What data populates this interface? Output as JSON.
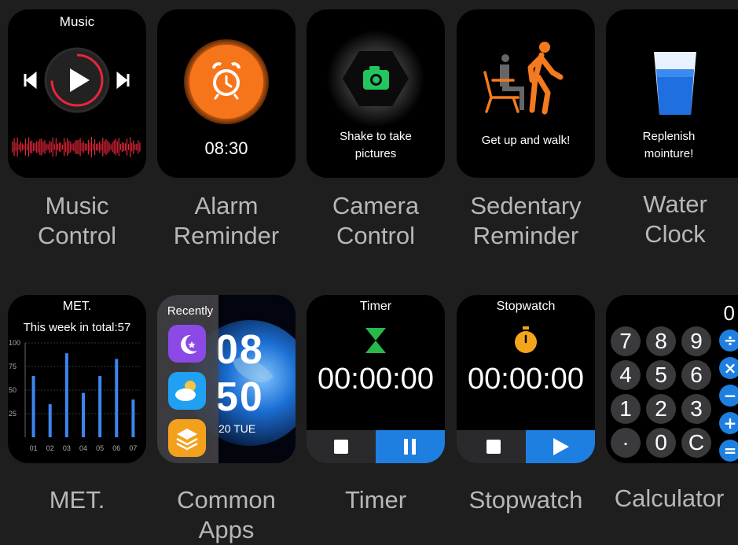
{
  "tiles": {
    "music": {
      "title": "Music",
      "caption": [
        "Music",
        "Control"
      ]
    },
    "alarm": {
      "time": "08:30",
      "caption": [
        "Alarm",
        "Reminder"
      ]
    },
    "camera": {
      "text": [
        "Shake to take",
        "pictures"
      ],
      "caption": [
        "Camera",
        "Control"
      ]
    },
    "sedentary": {
      "text": "Get up and walk!",
      "caption": [
        "Sedentary",
        "Reminder"
      ]
    },
    "water": {
      "text": [
        "Replenish",
        "mointure!"
      ],
      "caption": [
        "Water",
        "Clock"
      ]
    },
    "met": {
      "title": "MET.",
      "subtitle": "This week in total:57",
      "caption": [
        "MET."
      ]
    },
    "apps": {
      "header": "Recently",
      "clock_hour": "08",
      "clock_min": "50",
      "date": "20 TUE",
      "caption": [
        "Common",
        "Apps"
      ]
    },
    "timer": {
      "title": "Timer",
      "time": "00:00:00",
      "caption": [
        "Timer"
      ]
    },
    "stopwatch": {
      "title": "Stopwatch",
      "time": "00:00:00",
      "caption": [
        "Stopwatch"
      ]
    },
    "calculator": {
      "display": "0",
      "keys": [
        "7",
        "8",
        "9",
        "4",
        "5",
        "6",
        "1",
        "2",
        "3",
        "·",
        "0",
        "C"
      ],
      "ops": [
        "÷",
        "×",
        "−",
        "+",
        "="
      ],
      "caption": [
        "Calculator"
      ]
    }
  },
  "chart_data": {
    "type": "bar",
    "categories": [
      "01",
      "02",
      "03",
      "04",
      "05",
      "06",
      "07"
    ],
    "values": [
      65,
      35,
      89,
      47,
      65,
      83,
      40
    ],
    "title": "MET.",
    "subtitle": "This week in total:57",
    "yticks": [
      "100",
      "75",
      "50",
      "25"
    ],
    "ylim": [
      0,
      100
    ]
  },
  "colors": {
    "accent_orange": "#f47a1f",
    "accent_blue": "#1e7fe0",
    "camera_green": "#22c55e",
    "music_red": "#e8263a",
    "chart_bar": "#3d86ef"
  }
}
